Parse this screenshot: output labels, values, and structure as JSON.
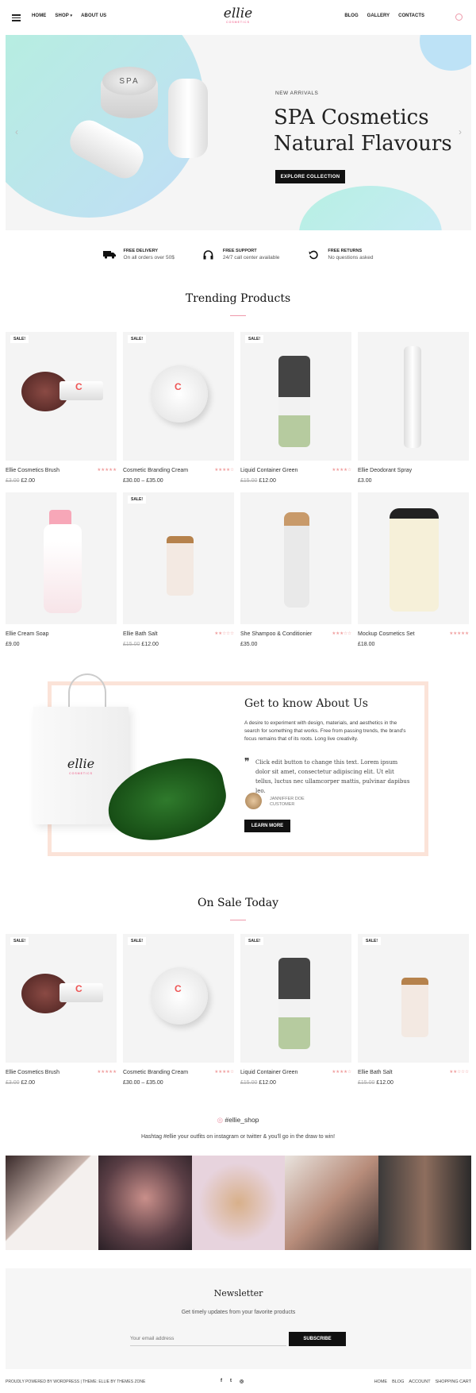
{
  "header": {
    "nav_left": [
      "HOME",
      "SHOP",
      "ABOUT US"
    ],
    "logo": "ellie",
    "logo_sub": "COSMETICS",
    "nav_right": [
      "BLOG",
      "GALLERY",
      "CONTACTS"
    ]
  },
  "hero": {
    "eyebrow": "NEW ARRIVALS",
    "title_line1": "SPA Cosmetics",
    "title_line2": "Natural Flavours",
    "button": "EXPLORE COLLECTION",
    "jar_label": "SPA"
  },
  "features": [
    {
      "icon": "truck-icon",
      "title": "FREE DELIVERY",
      "sub": "On all orders over 50$"
    },
    {
      "icon": "headphones-icon",
      "title": "FREE SUPPORT",
      "sub": "24/7 call center available"
    },
    {
      "icon": "returns-icon",
      "title": "FREE RETURNS",
      "sub": "No questions asked"
    }
  ],
  "trending": {
    "title": "Trending Products",
    "products": [
      {
        "name": "Ellie Cosmetics Brush",
        "old": "£3.00",
        "price": "£2.00",
        "sale": "SALE!"
      },
      {
        "name": "Cosmetic Branding Cream",
        "old": "",
        "price": "£30.00 – £35.00",
        "sale": "SALE!"
      },
      {
        "name": "Liquid Container Green",
        "old": "£15.00",
        "price": "£12.00",
        "sale": "SALE!"
      },
      {
        "name": "Ellie Deodorant Spray",
        "old": "",
        "price": "£3.00",
        "sale": ""
      },
      {
        "name": "Ellie Cream Soap",
        "old": "",
        "price": "£9.00",
        "sale": ""
      },
      {
        "name": "Ellie Bath Salt",
        "old": "£15.00",
        "price": "£12.00",
        "sale": "SALE!"
      },
      {
        "name": "She Shampoo & Conditionier",
        "old": "",
        "price": "£35.00",
        "sale": ""
      },
      {
        "name": "Mockup Cosmetics Set",
        "old": "",
        "price": "£18.00",
        "sale": ""
      }
    ]
  },
  "about": {
    "title": "Get to know About Us",
    "text": "A desire to experiment with design, materials, and aesthetics in the search for something that works. Free from passing trends, the brand's focus remains that of its roots. Long live creativity.",
    "quote": "Click edit button to change this text. Lorem ipsum dolor sit amet, consectetur adipiscing elit. Ut elit tellus, luctus nec ullamcorper mattis, pulvinar dapibus leo.",
    "author": "JANNIFFER DOE",
    "role": "CUSTOMER",
    "button": "LEARN MORE",
    "bag_logo": "ellie",
    "bag_sub": "COSMETICS"
  },
  "sale": {
    "title": "On Sale Today",
    "products": [
      {
        "name": "Ellie Cosmetics Brush",
        "old": "£3.00",
        "price": "£2.00",
        "sale": "SALE!"
      },
      {
        "name": "Cosmetic Branding Cream",
        "old": "",
        "price": "£30.00 – £35.00",
        "sale": "SALE!"
      },
      {
        "name": "Liquid Container Green",
        "old": "£15.00",
        "price": "£12.00",
        "sale": "SALE!"
      },
      {
        "name": "Ellie Bath Salt",
        "old": "£15.00",
        "price": "£12.00",
        "sale": "SALE!"
      }
    ]
  },
  "instagram": {
    "tag": "#ellie_shop",
    "sub": "Hashtag #ellie your outfits on instagram or twitter & you'll go in the draw to win!"
  },
  "newsletter": {
    "title": "Newsletter",
    "sub": "Get timely updates from your favorite products",
    "placeholder": "Your email address",
    "button": "SUBSCRIBE"
  },
  "footer": {
    "left": "PROUDLY POWERED BY WORDPRESS | THEME: ELLIE BY THEMES ZONE",
    "social": [
      "f",
      "t",
      "◎"
    ],
    "links": [
      "HOME",
      "BLOG",
      "ACCOUNT",
      "SHOPPING CART"
    ]
  }
}
